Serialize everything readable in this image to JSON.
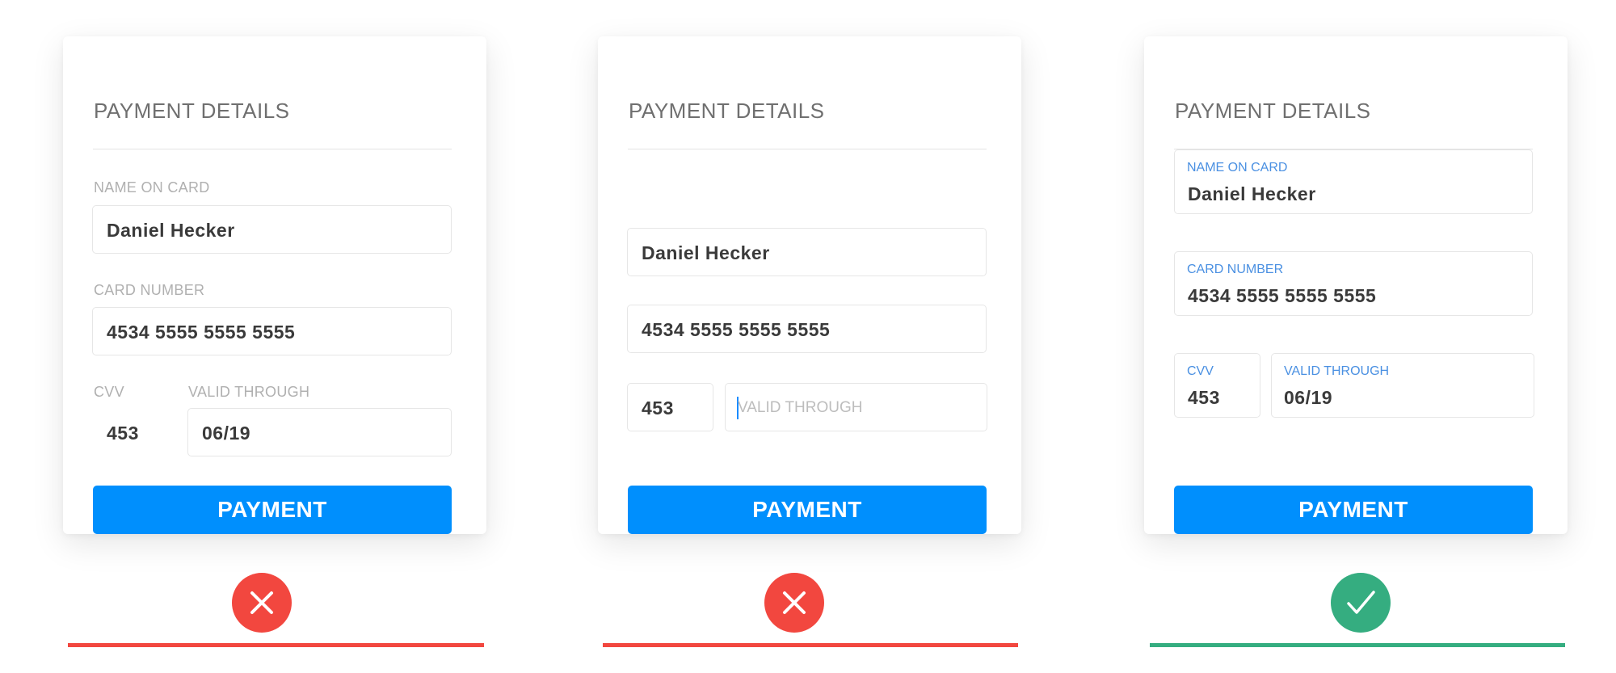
{
  "colors": {
    "accent": "#008ffd",
    "error": "#f2473f",
    "success": "#35ad80",
    "focus_label": "#4a90e2"
  },
  "cards": [
    {
      "title": "PAYMENT DETAILS",
      "name_label": "NAME ON CARD",
      "name_value": "Daniel Hecker",
      "number_label": "CARD NUMBER",
      "number_value": "4534 5555 5555 5555",
      "cvv_label": "CVV",
      "cvv_value": "453",
      "valid_label": "VALID THROUGH",
      "valid_value": "06/19",
      "button": "PAYMENT",
      "status": "x-icon"
    },
    {
      "title": "PAYMENT DETAILS",
      "name_value": "Daniel Hecker",
      "number_value": "4534 5555 5555 5555",
      "cvv_value": "453",
      "valid_placeholder": "VALID THROUGH",
      "button": "PAYMENT",
      "status": "x-icon"
    },
    {
      "title": "PAYMENT DETAILS",
      "name_label": "NAME ON CARD",
      "name_value": "Daniel Hecker",
      "number_label": "CARD NUMBER",
      "number_value": "4534 5555 5555 5555",
      "cvv_label": "CVV",
      "cvv_value": "453",
      "valid_label": "VALID THROUGH",
      "valid_value": "06/19",
      "button": "PAYMENT",
      "status": "check-icon"
    }
  ]
}
